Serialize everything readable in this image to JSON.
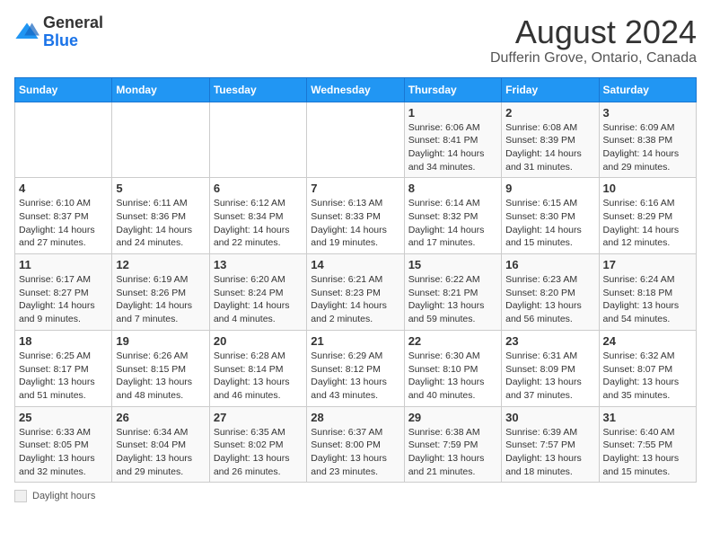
{
  "logo": {
    "general": "General",
    "blue": "Blue"
  },
  "title": "August 2024",
  "subtitle": "Dufferin Grove, Ontario, Canada",
  "days_of_week": [
    "Sunday",
    "Monday",
    "Tuesday",
    "Wednesday",
    "Thursday",
    "Friday",
    "Saturday"
  ],
  "weeks": [
    [
      {
        "day": "",
        "info": ""
      },
      {
        "day": "",
        "info": ""
      },
      {
        "day": "",
        "info": ""
      },
      {
        "day": "",
        "info": ""
      },
      {
        "day": "1",
        "info": "Sunrise: 6:06 AM\nSunset: 8:41 PM\nDaylight: 14 hours and 34 minutes."
      },
      {
        "day": "2",
        "info": "Sunrise: 6:08 AM\nSunset: 8:39 PM\nDaylight: 14 hours and 31 minutes."
      },
      {
        "day": "3",
        "info": "Sunrise: 6:09 AM\nSunset: 8:38 PM\nDaylight: 14 hours and 29 minutes."
      }
    ],
    [
      {
        "day": "4",
        "info": "Sunrise: 6:10 AM\nSunset: 8:37 PM\nDaylight: 14 hours and 27 minutes."
      },
      {
        "day": "5",
        "info": "Sunrise: 6:11 AM\nSunset: 8:36 PM\nDaylight: 14 hours and 24 minutes."
      },
      {
        "day": "6",
        "info": "Sunrise: 6:12 AM\nSunset: 8:34 PM\nDaylight: 14 hours and 22 minutes."
      },
      {
        "day": "7",
        "info": "Sunrise: 6:13 AM\nSunset: 8:33 PM\nDaylight: 14 hours and 19 minutes."
      },
      {
        "day": "8",
        "info": "Sunrise: 6:14 AM\nSunset: 8:32 PM\nDaylight: 14 hours and 17 minutes."
      },
      {
        "day": "9",
        "info": "Sunrise: 6:15 AM\nSunset: 8:30 PM\nDaylight: 14 hours and 15 minutes."
      },
      {
        "day": "10",
        "info": "Sunrise: 6:16 AM\nSunset: 8:29 PM\nDaylight: 14 hours and 12 minutes."
      }
    ],
    [
      {
        "day": "11",
        "info": "Sunrise: 6:17 AM\nSunset: 8:27 PM\nDaylight: 14 hours and 9 minutes."
      },
      {
        "day": "12",
        "info": "Sunrise: 6:19 AM\nSunset: 8:26 PM\nDaylight: 14 hours and 7 minutes."
      },
      {
        "day": "13",
        "info": "Sunrise: 6:20 AM\nSunset: 8:24 PM\nDaylight: 14 hours and 4 minutes."
      },
      {
        "day": "14",
        "info": "Sunrise: 6:21 AM\nSunset: 8:23 PM\nDaylight: 14 hours and 2 minutes."
      },
      {
        "day": "15",
        "info": "Sunrise: 6:22 AM\nSunset: 8:21 PM\nDaylight: 13 hours and 59 minutes."
      },
      {
        "day": "16",
        "info": "Sunrise: 6:23 AM\nSunset: 8:20 PM\nDaylight: 13 hours and 56 minutes."
      },
      {
        "day": "17",
        "info": "Sunrise: 6:24 AM\nSunset: 8:18 PM\nDaylight: 13 hours and 54 minutes."
      }
    ],
    [
      {
        "day": "18",
        "info": "Sunrise: 6:25 AM\nSunset: 8:17 PM\nDaylight: 13 hours and 51 minutes."
      },
      {
        "day": "19",
        "info": "Sunrise: 6:26 AM\nSunset: 8:15 PM\nDaylight: 13 hours and 48 minutes."
      },
      {
        "day": "20",
        "info": "Sunrise: 6:28 AM\nSunset: 8:14 PM\nDaylight: 13 hours and 46 minutes."
      },
      {
        "day": "21",
        "info": "Sunrise: 6:29 AM\nSunset: 8:12 PM\nDaylight: 13 hours and 43 minutes."
      },
      {
        "day": "22",
        "info": "Sunrise: 6:30 AM\nSunset: 8:10 PM\nDaylight: 13 hours and 40 minutes."
      },
      {
        "day": "23",
        "info": "Sunrise: 6:31 AM\nSunset: 8:09 PM\nDaylight: 13 hours and 37 minutes."
      },
      {
        "day": "24",
        "info": "Sunrise: 6:32 AM\nSunset: 8:07 PM\nDaylight: 13 hours and 35 minutes."
      }
    ],
    [
      {
        "day": "25",
        "info": "Sunrise: 6:33 AM\nSunset: 8:05 PM\nDaylight: 13 hours and 32 minutes."
      },
      {
        "day": "26",
        "info": "Sunrise: 6:34 AM\nSunset: 8:04 PM\nDaylight: 13 hours and 29 minutes."
      },
      {
        "day": "27",
        "info": "Sunrise: 6:35 AM\nSunset: 8:02 PM\nDaylight: 13 hours and 26 minutes."
      },
      {
        "day": "28",
        "info": "Sunrise: 6:37 AM\nSunset: 8:00 PM\nDaylight: 13 hours and 23 minutes."
      },
      {
        "day": "29",
        "info": "Sunrise: 6:38 AM\nSunset: 7:59 PM\nDaylight: 13 hours and 21 minutes."
      },
      {
        "day": "30",
        "info": "Sunrise: 6:39 AM\nSunset: 7:57 PM\nDaylight: 13 hours and 18 minutes."
      },
      {
        "day": "31",
        "info": "Sunrise: 6:40 AM\nSunset: 7:55 PM\nDaylight: 13 hours and 15 minutes."
      }
    ]
  ],
  "footer": {
    "note": "Daylight hours"
  }
}
